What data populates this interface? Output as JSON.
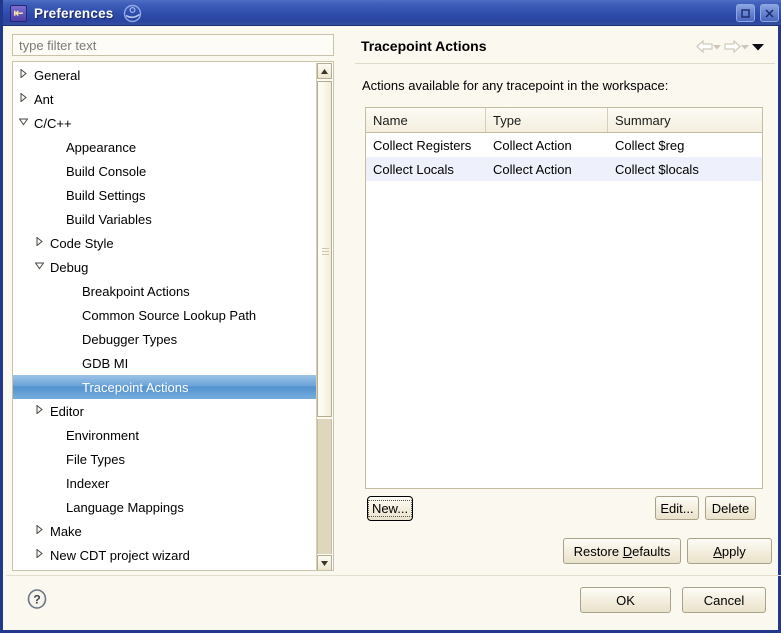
{
  "window": {
    "title": "Preferences",
    "app_icon": "eclipse-icon",
    "logo_icon": "eclipse-logo-icon",
    "maximize_label": "maximize-icon",
    "close_label": "close-icon"
  },
  "filter": {
    "placeholder": "type filter text",
    "value": ""
  },
  "tree": {
    "items": [
      {
        "label": "General",
        "indent": 0,
        "arrow": "collapsed",
        "selected": false
      },
      {
        "label": "Ant",
        "indent": 0,
        "arrow": "collapsed",
        "selected": false
      },
      {
        "label": "C/C++",
        "indent": 0,
        "arrow": "expanded",
        "selected": false
      },
      {
        "label": "Appearance",
        "indent": 2,
        "arrow": "none",
        "selected": false
      },
      {
        "label": "Build Console",
        "indent": 2,
        "arrow": "none",
        "selected": false
      },
      {
        "label": "Build Settings",
        "indent": 2,
        "arrow": "none",
        "selected": false
      },
      {
        "label": "Build Variables",
        "indent": 2,
        "arrow": "none",
        "selected": false
      },
      {
        "label": "Code Style",
        "indent": 1,
        "arrow": "collapsed",
        "selected": false
      },
      {
        "label": "Debug",
        "indent": 1,
        "arrow": "expanded",
        "selected": false
      },
      {
        "label": "Breakpoint Actions",
        "indent": 3,
        "arrow": "none",
        "selected": false
      },
      {
        "label": "Common Source Lookup Path",
        "indent": 3,
        "arrow": "none",
        "selected": false
      },
      {
        "label": "Debugger Types",
        "indent": 3,
        "arrow": "none",
        "selected": false
      },
      {
        "label": "GDB MI",
        "indent": 3,
        "arrow": "none",
        "selected": false
      },
      {
        "label": "Tracepoint Actions",
        "indent": 3,
        "arrow": "none",
        "selected": true
      },
      {
        "label": "Editor",
        "indent": 1,
        "arrow": "collapsed",
        "selected": false
      },
      {
        "label": "Environment",
        "indent": 2,
        "arrow": "none",
        "selected": false
      },
      {
        "label": "File Types",
        "indent": 2,
        "arrow": "none",
        "selected": false
      },
      {
        "label": "Indexer",
        "indent": 2,
        "arrow": "none",
        "selected": false
      },
      {
        "label": "Language Mappings",
        "indent": 2,
        "arrow": "none",
        "selected": false
      },
      {
        "label": "Make",
        "indent": 1,
        "arrow": "collapsed",
        "selected": false
      },
      {
        "label": "New CDT project wizard",
        "indent": 1,
        "arrow": "collapsed",
        "selected": false
      }
    ]
  },
  "scrollbar": {
    "up_icon": "scroll-up-icon",
    "down_icon": "scroll-down-icon"
  },
  "right_panel": {
    "title": "Tracepoint Actions",
    "description": "Actions available for any tracepoint in the workspace:",
    "nav": {
      "back_icon": "back-arrow-icon",
      "back_menu_icon": "chevron-down-icon",
      "forward_icon": "forward-arrow-icon",
      "forward_menu_icon": "chevron-down-icon",
      "menu_icon": "view-menu-chevron-icon"
    },
    "table": {
      "columns": [
        "Name",
        "Type",
        "Summary"
      ],
      "rows": [
        {
          "name": "Collect Registers",
          "type": "Collect Action",
          "summary": "Collect $reg"
        },
        {
          "name": "Collect Locals",
          "type": "Collect Action",
          "summary": "Collect $locals"
        }
      ]
    },
    "buttons": {
      "new": "New...",
      "edit": "Edit...",
      "delete": "Delete",
      "restore_defaults_pre": "Restore ",
      "restore_defaults_mnemonic": "D",
      "restore_defaults_post": "efaults",
      "apply_mnemonic": "A",
      "apply_post": "pply"
    }
  },
  "footer": {
    "help_icon": "help-question-icon",
    "ok": "OK",
    "cancel": "Cancel"
  },
  "colors": {
    "title_bar": "#2f4cac",
    "selection": "#6ba3d8",
    "panel_bg": "#fbf8ef",
    "alt_row": "#eef0fb",
    "border": "#c4bc9e"
  }
}
